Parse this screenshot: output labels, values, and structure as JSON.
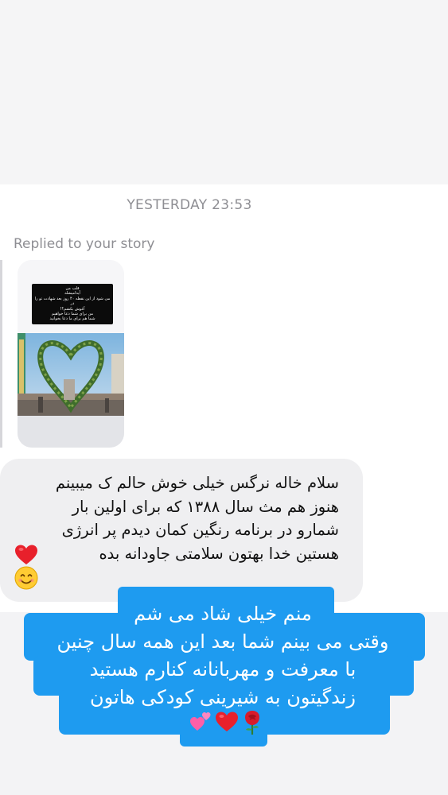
{
  "conversation": {
    "timestamp": "YESTERDAY 23:53",
    "replied_label": "Replied to your story"
  },
  "story": {
    "caption_lines": [
      "قلب من",
      "آیدامیشله",
      "می شود از این نقطه ۴۰ روز بعد شهادت تو را در",
      "آغوش بکشم؟!",
      "من برای شما دعا خواهیم",
      "شما هم برای ما دعا بخوانید"
    ]
  },
  "message": {
    "lines": [
      "سلام خاله نرگس خیلی خوش حالم ک میبینم",
      "هنوز هم مث سال ۱۳۸۸ که برای اولین بار",
      "شمارو در برنامه رنگین کمان دیدم پر انرژی",
      "هستین خدا بهتون  سلامتی جاودانه بده"
    ],
    "emojis": [
      "red-heart",
      "smiling-face"
    ]
  },
  "sticker": {
    "color": "#1e9bf0",
    "lines": [
      "منم خیلی شاد می شم",
      "وقتی می بینم شما بعد این همه سال چنین",
      "با معرفت و مهربانانه کنارم هستید",
      "زندگیتون به شیرینی کودکی هاتون"
    ],
    "emojis": [
      "rose",
      "red-heart",
      "two-hearts"
    ]
  }
}
